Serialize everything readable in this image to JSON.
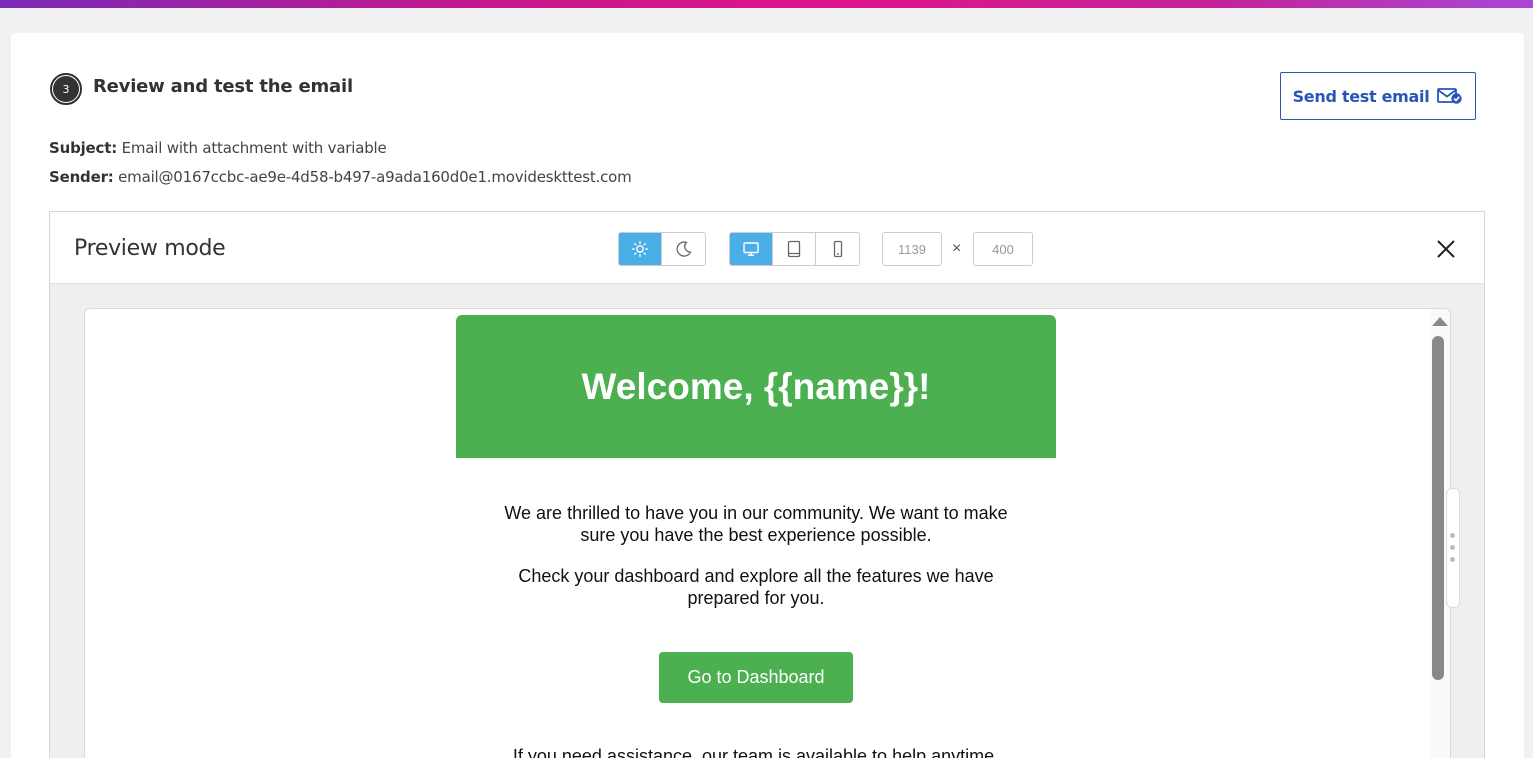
{
  "step": {
    "number": "3",
    "title": "Review and test the email"
  },
  "actions": {
    "send_test_label": "Send test email",
    "send_test_icon": "mail-check-icon"
  },
  "meta": {
    "subject_label": "Subject:",
    "subject_value": "Email with attachment with variable",
    "sender_label": "Sender:",
    "sender_value": "email@0167ccbc-ae9e-4d58-b497-a9ada160d0e1.movideskttest.com"
  },
  "preview": {
    "title": "Preview mode",
    "theme_options": [
      {
        "icon": "sun-icon",
        "active": true
      },
      {
        "icon": "moon-icon",
        "active": false
      }
    ],
    "device_options": [
      {
        "icon": "desktop-icon",
        "active": true
      },
      {
        "icon": "tablet-icon",
        "active": false
      },
      {
        "icon": "mobile-icon",
        "active": false
      }
    ],
    "width_value": "1139",
    "height_value": "400",
    "times_symbol": "×",
    "close_icon": "close-icon"
  },
  "email": {
    "heading": "Welcome, {{name}}!",
    "paragraph1": "We are thrilled to have you in our community. We want to make sure you have the best experience possible.",
    "paragraph2": "Check your dashboard and explore all the features we have prepared for you.",
    "cta_label": "Go to Dashboard",
    "paragraph3": "If you need assistance, our team is available to help anytime."
  },
  "colors": {
    "accent_blue": "#2a54b8",
    "active_toggle": "#4aaee8",
    "email_green": "#4caf50"
  }
}
